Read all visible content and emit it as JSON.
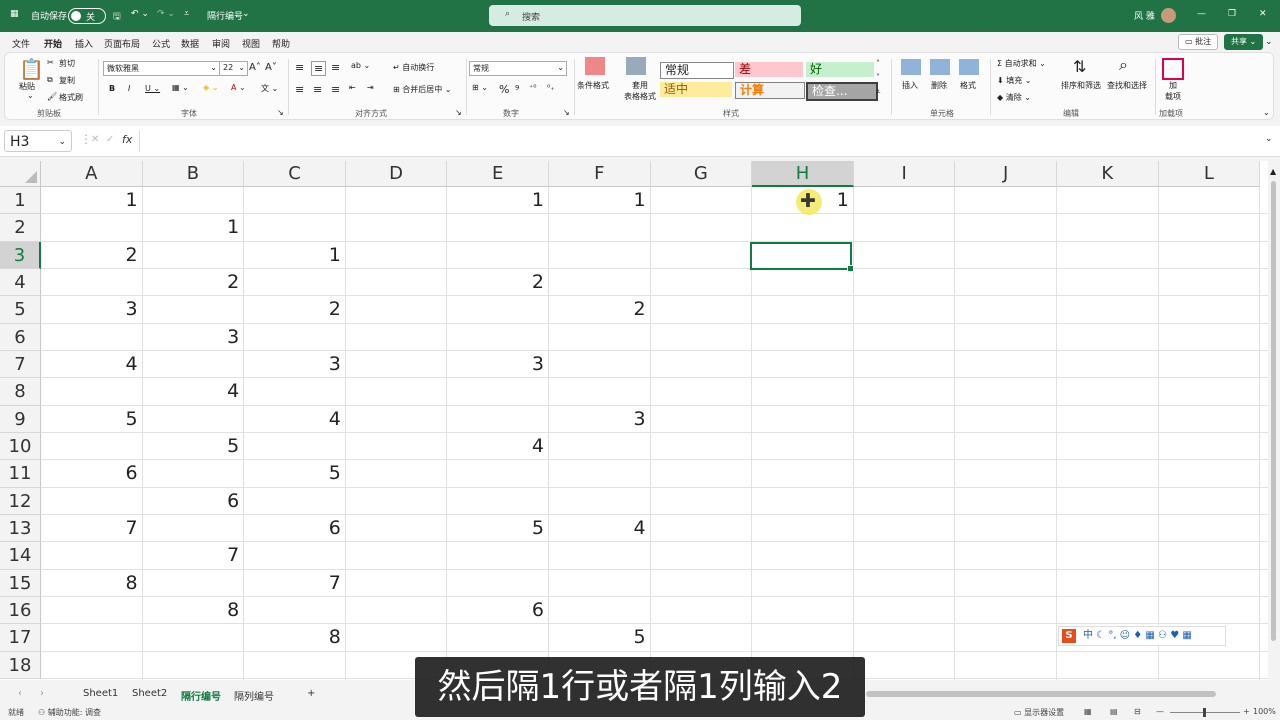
{
  "titlebar": {
    "autosave": "自动保存",
    "toggle": "关",
    "filename": "隔行编号",
    "search_placeholder": "搜索",
    "user": "风 雅"
  },
  "menu": {
    "items": [
      "文件",
      "开始",
      "插入",
      "页面布局",
      "公式",
      "数据",
      "审阅",
      "视图",
      "帮助"
    ],
    "comment": "批注",
    "share": "共享"
  },
  "ribbon": {
    "paste": "粘贴",
    "cut": "剪切",
    "copy": "复制",
    "format_painter": "格式刷",
    "clipboard": "剪贴板",
    "font_name": "微软雅黑",
    "font_size": "22",
    "font_group": "字体",
    "wrap": "自动换行",
    "merge": "合并后居中",
    "align_group": "对齐方式",
    "number_format": "常规",
    "number_group": "数字",
    "cond_format": "条件格式",
    "table_format": "套用\n表格格式",
    "styles_group": "样式",
    "style_normal": "常规",
    "style_bad": "差",
    "style_good": "好",
    "style_neutral": "适中",
    "style_calc": "计算",
    "style_check": "检查...",
    "insert": "插入",
    "delete": "删除",
    "format": "格式",
    "cells_group": "单元格",
    "autosum": "自动求和",
    "fill": "填充",
    "clear": "清除",
    "sort": "排序和筛选",
    "find": "查找和选择",
    "edit_group": "编辑",
    "addin": "加\n载项",
    "addin_group": "加载项"
  },
  "formula": {
    "namebox": "H3",
    "fx": "fx"
  },
  "columns": [
    "A",
    "B",
    "C",
    "D",
    "E",
    "F",
    "G",
    "H",
    "I",
    "J",
    "K",
    "L"
  ],
  "rows": [
    "1",
    "2",
    "3",
    "4",
    "5",
    "6",
    "7",
    "8",
    "9",
    "10",
    "11",
    "12",
    "13",
    "14",
    "15",
    "16",
    "17",
    "18"
  ],
  "cells": {
    "A": [
      "1",
      "",
      "2",
      "",
      "3",
      "",
      "4",
      "",
      "5",
      "",
      "6",
      "",
      "7",
      "",
      "8",
      "",
      "",
      ""
    ],
    "B": [
      "",
      "1",
      "",
      "2",
      "",
      "3",
      "",
      "4",
      "",
      "5",
      "",
      "6",
      "",
      "7",
      "",
      "8",
      "",
      ""
    ],
    "C": [
      "",
      "",
      "1",
      "",
      "2",
      "",
      "3",
      "",
      "4",
      "",
      "5",
      "",
      "6",
      "",
      "7",
      "",
      "8",
      ""
    ],
    "E": [
      "1",
      "",
      "",
      "2",
      "",
      "",
      "3",
      "",
      "",
      "4",
      "",
      "",
      "5",
      "",
      "",
      "6",
      "",
      ""
    ],
    "F": [
      "1",
      "",
      "",
      "",
      "2",
      "",
      "",
      "",
      "3",
      "",
      "",
      "",
      "4",
      "",
      "",
      "",
      "5",
      ""
    ],
    "H": [
      "1",
      "",
      "",
      "",
      "",
      "",
      "",
      "",
      "",
      "",
      "",
      "",
      "",
      "",
      "",
      "",
      "",
      ""
    ]
  },
  "sheets": [
    "Sheet1",
    "Sheet2",
    "隔行编号",
    "隔列编号"
  ],
  "active_sheet": "隔行编号",
  "status": {
    "ready": "就绪",
    "accessibility": "辅助功能: 调查",
    "display": "显示器设置",
    "zoom": "100%"
  },
  "caption": "然后隔1行或者隔1列输入2",
  "ime": "中 ☾ °, ☺ ♦ ▦ ⚇ ♥ ▦"
}
